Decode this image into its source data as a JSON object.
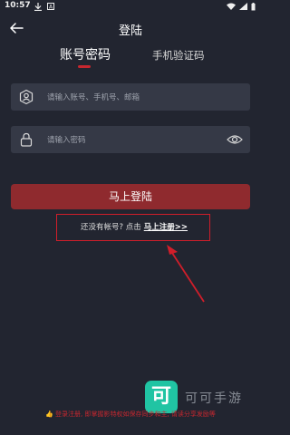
{
  "status_bar": {
    "time": "10:57"
  },
  "header": {
    "title": "登陆"
  },
  "tabs": [
    {
      "label": "账号密码"
    },
    {
      "label": "手机验证码"
    }
  ],
  "account_field": {
    "placeholder": "请输入账号、手机号、邮箱"
  },
  "password_field": {
    "placeholder": "请输入密码"
  },
  "login_button": {
    "label": "马上登陆"
  },
  "register": {
    "prompt": "还没有帐号? 点击",
    "link": "马上注册>>"
  },
  "watermark": {
    "logo_char": "可",
    "text": "可可手游"
  },
  "agreement": {
    "text": "登录注册, 即掌握影特权如保存同步和主, 请读分享发励等"
  },
  "colors": {
    "background": "#222530",
    "accent": "#c6272f",
    "field": "#353946",
    "button": "#8f2a2e"
  }
}
